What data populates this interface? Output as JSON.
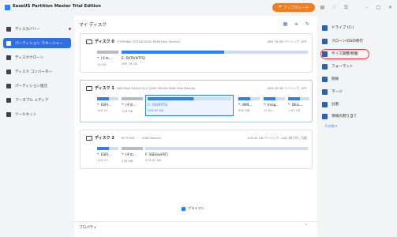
{
  "app": {
    "title": "EaseUS Partition Master Trial Edition",
    "upgrade_label": "アップグレード"
  },
  "sidebar": {
    "items": [
      {
        "label": "ディスカバリー"
      },
      {
        "label": "パーティション マネージャー"
      },
      {
        "label": "ディスククローン"
      },
      {
        "label": "ディスク コンバーター"
      },
      {
        "label": "パーティション復元"
      },
      {
        "label": "ブータブル メディア"
      },
      {
        "label": "ツールキット"
      }
    ]
  },
  "main": {
    "title": "マイ ディスク",
    "disks": [
      {
        "name": "ディスク 0",
        "desc": "(TOSHIBA DT01ACA200 RAID Disk Device)",
        "meta": "465.76 GB ベーシック, GPT",
        "partitions": [
          {
            "label": "*: (その...",
            "size": "15.98..."
          },
          {
            "label": "E: DATA(NTFS)",
            "size": "465.76 GB"
          }
        ]
      },
      {
        "name": "ディスク 1",
        "desc": "(WD Blue SA510 M.2 2280 500GB RAID Disk Device)",
        "meta": "465.76 GB ベーシック, GPT",
        "partitions": [
          {
            "label": "*: ESP(...",
            "size": "149.47..."
          },
          {
            "label": "*: (その...",
            "size": "128 MB"
          },
          {
            "label": "C: OS(NTFS)",
            "size": "452.67 GB"
          },
          {
            "label": "*: WIN...",
            "size": "990 MB"
          },
          {
            "label": "*: Imag...",
            "size": "10.62..."
          },
          {
            "label": "*: DELL...",
            "size": "1.29 GB"
          }
        ]
      },
      {
        "name": "ディスク 2",
        "desc_prefix": "SP PCM3",
        "desc": "(USB Device)",
        "meta": "476.94 GB ベーシック, USB, 取り外し可能",
        "partitions": [
          {
            "label": "*: ESP(...",
            "size": "149.47..."
          },
          {
            "label": "*: (その...",
            "size": "128 MB"
          },
          {
            "label": "F: SSD(exFAT)",
            "size": "476.67 GB"
          }
        ]
      }
    ],
    "legend": "プライマリ",
    "properties": "プロパティ"
  },
  "actions": {
    "items": [
      {
        "label": "ドライブ (C:)"
      },
      {
        "label": "クローン/OSの移行"
      },
      {
        "label": "サイズ調整/移動"
      },
      {
        "label": "フォーマット"
      },
      {
        "label": "削除"
      },
      {
        "label": "マージ"
      },
      {
        "label": "分割"
      },
      {
        "label": "領域の割り当て"
      }
    ],
    "more": "その他"
  },
  "colors": {
    "accent": "#2d7ff9",
    "upgrade": "#ef7d22",
    "active_nav": "#2f6fe0",
    "highlight": "#e53935"
  }
}
